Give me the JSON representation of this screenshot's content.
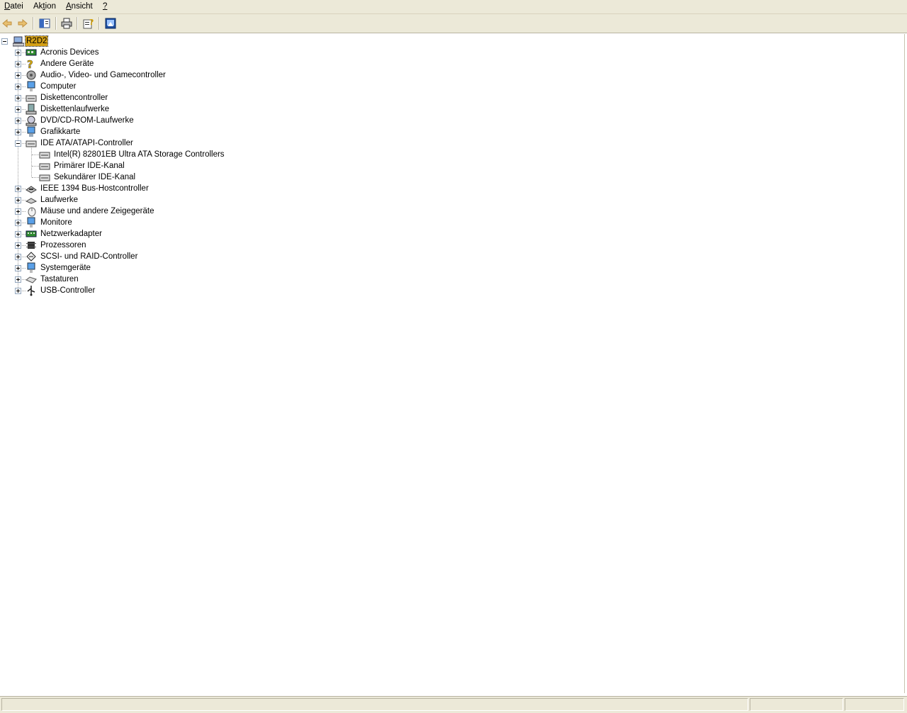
{
  "menu": {
    "items": [
      {
        "pre": "",
        "acc": "D",
        "post": "atei"
      },
      {
        "pre": "Ak",
        "acc": "t",
        "post": "ion"
      },
      {
        "pre": "",
        "acc": "A",
        "post": "nsicht"
      },
      {
        "pre": "",
        "acc": "?",
        "post": ""
      }
    ]
  },
  "toolbar": {
    "buttons": [
      "back-icon",
      "forward-icon",
      "show-hide-tree-icon",
      "print-icon",
      "properties-icon",
      "help-icon"
    ]
  },
  "tree": {
    "root": {
      "label": "R2D2",
      "icon": "computer-icon",
      "expanded": true,
      "selected": true
    },
    "categories": [
      {
        "label": "Acronis Devices",
        "icon": "card-icon"
      },
      {
        "label": "Andere Geräte",
        "icon": "unknown-device-icon"
      },
      {
        "label": "Audio-, Video- und Gamecontroller",
        "icon": "audio-icon"
      },
      {
        "label": "Computer",
        "icon": "computer-monitor-icon"
      },
      {
        "label": "Diskettencontroller",
        "icon": "controller-icon"
      },
      {
        "label": "Diskettenlaufwerke",
        "icon": "floppy-icon"
      },
      {
        "label": "DVD/CD-ROM-Laufwerke",
        "icon": "cdrom-icon"
      },
      {
        "label": "Grafikkarte",
        "icon": "display-icon"
      },
      {
        "label": "IDE ATA/ATAPI-Controller",
        "icon": "controller-icon",
        "expanded": true,
        "children": [
          {
            "label": "Intel(R) 82801EB Ultra ATA Storage Controllers",
            "icon": "controller-icon"
          },
          {
            "label": "Primärer IDE-Kanal",
            "icon": "controller-icon"
          },
          {
            "label": "Sekundärer IDE-Kanal",
            "icon": "controller-icon"
          }
        ]
      },
      {
        "label": "IEEE 1394 Bus-Hostcontroller",
        "icon": "firewire-icon"
      },
      {
        "label": "Laufwerke",
        "icon": "drive-icon"
      },
      {
        "label": "Mäuse und andere Zeigegeräte",
        "icon": "mouse-icon"
      },
      {
        "label": "Monitore",
        "icon": "monitor-icon"
      },
      {
        "label": "Netzwerkadapter",
        "icon": "network-card-icon"
      },
      {
        "label": "Prozessoren",
        "icon": "processor-icon"
      },
      {
        "label": "SCSI- und RAID-Controller",
        "icon": "scsi-icon"
      },
      {
        "label": "Systemgeräte",
        "icon": "system-icon"
      },
      {
        "label": "Tastaturen",
        "icon": "keyboard-icon"
      },
      {
        "label": "USB-Controller",
        "icon": "usb-icon"
      }
    ]
  },
  "colors": {
    "chrome": "#ece9d8",
    "selection": "#d4a017"
  }
}
